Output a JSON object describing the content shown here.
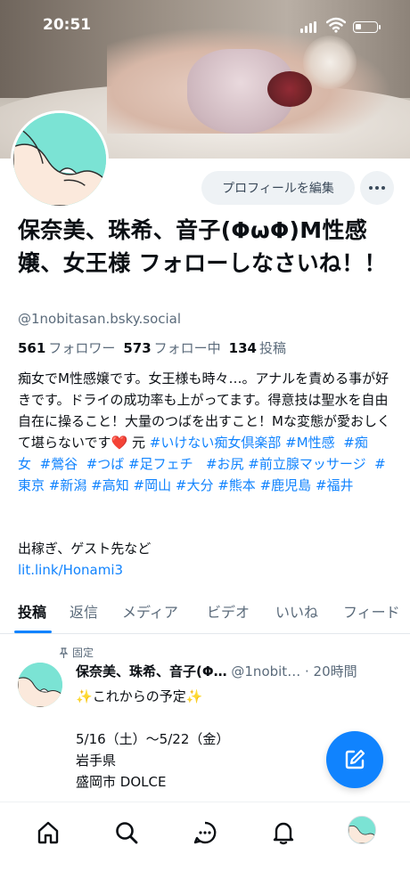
{
  "status_bar": {
    "time": "20:51"
  },
  "profile": {
    "display_name": "保奈美、珠希、音子(ΦωΦ)M性感嬢、女王様 フォローしなさいね！！",
    "handle": "@1nobitasan.bsky.social",
    "edit_button_label": "プロフィールを編集",
    "more_icon": "ellipsis-icon",
    "stats": [
      {
        "count": "561",
        "label": "フォロワー"
      },
      {
        "count": "573",
        "label": "フォロー中"
      },
      {
        "count": "134",
        "label": "投稿"
      }
    ],
    "bio_text": "痴女でM性感嬢です。女王様も時々…。アナルを責める事が好きです。ドライの成功率も上がってます。得意技は聖水を自由自在に操ること！大量のつばを出すこと！Mな変態が愛おしくて堪らないです",
    "bio_heart": "❤️",
    "bio_suffix": " 元 ",
    "hashtags": [
      "#いけない痴女倶楽部",
      "#M性感",
      "#痴女",
      "#鶯谷",
      "#つば",
      "#足フェチ",
      "#お尻",
      "#前立腺マッサージ",
      "#東京",
      "#新潟",
      "#高知",
      "#岡山",
      "#大分",
      "#熊本",
      "#鹿児島",
      "#福井"
    ],
    "bio_extra": "出稼ぎ、ゲスト先など",
    "bio_link": "lit.link/Honami3"
  },
  "tabs": [
    "投稿",
    "返信",
    "メディア",
    "ビデオ",
    "いいね",
    "フィード"
  ],
  "active_tab": "投稿",
  "post": {
    "pinned_label": "固定",
    "author_name": "保奈美、珠希、音子(Φ…",
    "author_handle": "@1nobit…",
    "time": "· 20時間",
    "sparkle": "✨",
    "title": "これからの予定",
    "lines": [
      "5/16（土）〜5/22（金）",
      "岩手県",
      "盛岡市 DOLCE"
    ]
  },
  "fab_icon": "compose-icon",
  "bottom_nav": [
    "home-icon",
    "search-icon",
    "chat-icon",
    "bell-icon",
    "profile-avatar"
  ],
  "colors": {
    "accent": "#1083fe",
    "muted": "#5b6b7b",
    "avatar_bg": "#7be3d4"
  }
}
